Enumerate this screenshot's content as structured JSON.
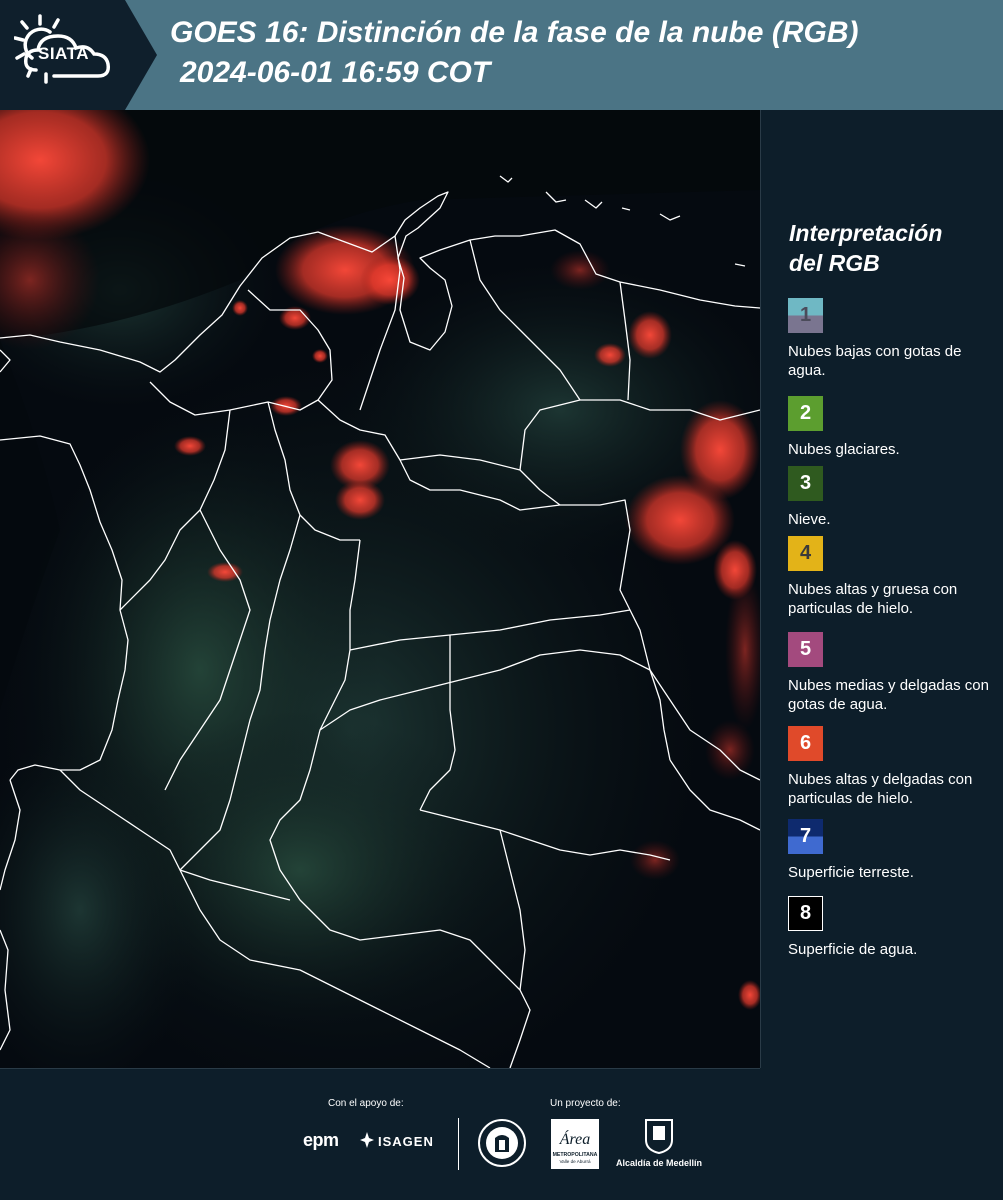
{
  "header": {
    "logo_text": "SIATA",
    "title": "GOES 16: Distinción de la fase de la nube (RGB)",
    "subtitle": "2024-06-01 16:59 COT"
  },
  "legend": {
    "title_line1": "Interpretación",
    "title_line2": "del RGB",
    "items": [
      {
        "number": "1",
        "label": "Nubes bajas con gotas de agua.",
        "color": "#6fb8c4",
        "color2": "#7a7590"
      },
      {
        "number": "2",
        "label": "Nubes glaciares.",
        "color": "#5c9e2f"
      },
      {
        "number": "3",
        "label": "Nieve.",
        "color": "#2f5a1f"
      },
      {
        "number": "4",
        "label": "Nubes altas y gruesa con particulas de hielo.",
        "color": "#e3b318"
      },
      {
        "number": "5",
        "label": "Nubes medias y delgadas con gotas de agua.",
        "color": "#a34a7e"
      },
      {
        "number": "6",
        "label": "Nubes altas y delgadas con particulas de hielo.",
        "color": "#e04a2a"
      },
      {
        "number": "7",
        "label": "Superficie terreste.",
        "color": "#0e2a6e",
        "color2": "#3f6ad0"
      },
      {
        "number": "8",
        "label": "Superficie de agua.",
        "color": "#000000"
      }
    ]
  },
  "footer": {
    "support_label": "Con el apoyo de:",
    "project_label": "Un proyecto de:",
    "epm": "epm",
    "isagen": "ISAGEN",
    "area_line1": "Área",
    "area_line2": "METROPOLITANA",
    "area_line3": "Valle de Aburrá",
    "alcaldia": "Alcaldía de Medellín"
  }
}
